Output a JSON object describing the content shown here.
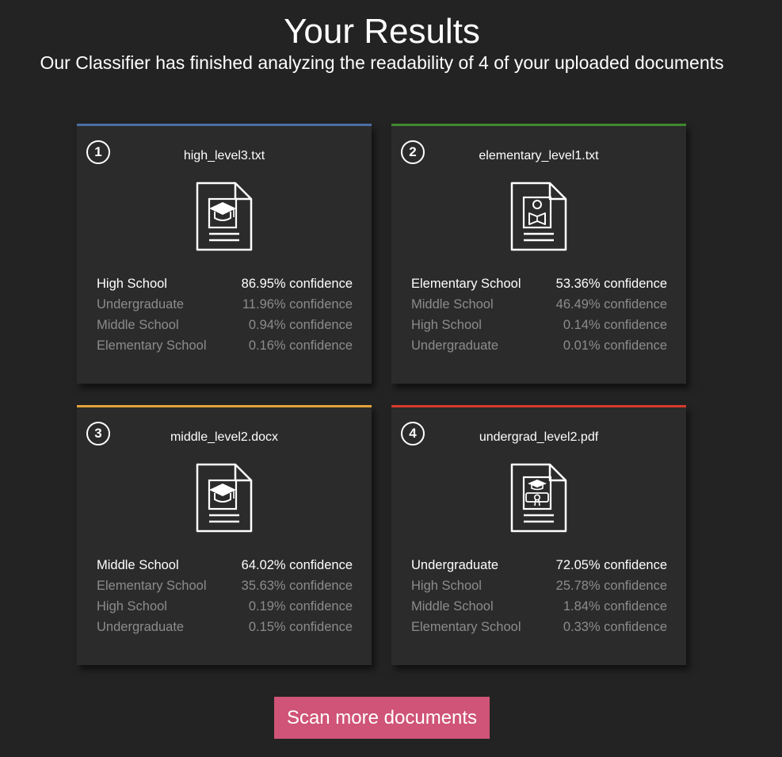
{
  "header": {
    "title": "Your Results",
    "subtitle": "Our Classifier has finished analyzing the readability of 4 of your uploaded documents"
  },
  "cards": [
    {
      "number": "1",
      "filename": "high_level3.txt",
      "accent_color": "#4a6fa5",
      "icon": "document-graduation-cap-icon",
      "results": [
        {
          "label": "High School",
          "confidence": "86.95% confidence"
        },
        {
          "label": "Undergraduate",
          "confidence": "11.96% confidence"
        },
        {
          "label": "Middle School",
          "confidence": "0.94% confidence"
        },
        {
          "label": "Elementary School",
          "confidence": "0.16% confidence"
        }
      ]
    },
    {
      "number": "2",
      "filename": "elementary_level1.txt",
      "accent_color": "#3e8a2f",
      "icon": "document-reading-child-icon",
      "results": [
        {
          "label": "Elementary School",
          "confidence": "53.36% confidence"
        },
        {
          "label": "Middle School",
          "confidence": "46.49% confidence"
        },
        {
          "label": "High School",
          "confidence": "0.14% confidence"
        },
        {
          "label": "Undergraduate",
          "confidence": "0.01% confidence"
        }
      ]
    },
    {
      "number": "3",
      "filename": "middle_level2.docx",
      "accent_color": "#e3a23c",
      "icon": "document-graduation-cap-icon",
      "results": [
        {
          "label": "Middle School",
          "confidence": "64.02% confidence"
        },
        {
          "label": "Elementary School",
          "confidence": "35.63% confidence"
        },
        {
          "label": "High School",
          "confidence": "0.19% confidence"
        },
        {
          "label": "Undergraduate",
          "confidence": "0.15% confidence"
        }
      ]
    },
    {
      "number": "4",
      "filename": "undergrad_level2.pdf",
      "accent_color": "#d83a2e",
      "icon": "document-diploma-icon",
      "results": [
        {
          "label": "Undergraduate",
          "confidence": "72.05% confidence"
        },
        {
          "label": "High School",
          "confidence": "25.78% confidence"
        },
        {
          "label": "Middle School",
          "confidence": "1.84% confidence"
        },
        {
          "label": "Elementary School",
          "confidence": "0.33% confidence"
        }
      ]
    }
  ],
  "actions": {
    "scan_more_label": "Scan more documents",
    "scan_more_color": "#cf5477"
  }
}
